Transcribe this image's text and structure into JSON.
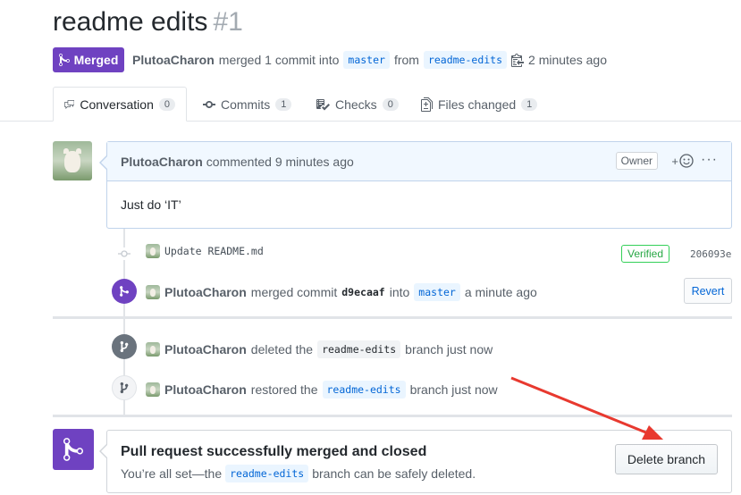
{
  "pr": {
    "title": "readme edits",
    "number": "#1",
    "status": "Merged",
    "author": "PlutoaCharon",
    "merged_text": "merged 1 commit into",
    "base_branch": "master",
    "from_text": "from",
    "head_branch": "readme-edits",
    "time": "2 minutes ago"
  },
  "tabs": [
    {
      "label": "Conversation",
      "count": "0",
      "icon": "conversation-icon"
    },
    {
      "label": "Commits",
      "count": "1",
      "icon": "commit-icon"
    },
    {
      "label": "Checks",
      "count": "0",
      "icon": "checklist-icon"
    },
    {
      "label": "Files changed",
      "count": "1",
      "icon": "file-diff-icon"
    }
  ],
  "comment": {
    "author": "PlutoaCharon",
    "action": "commented 9 minutes ago",
    "owner_label": "Owner",
    "reaction_label": "+",
    "more": "···",
    "body": "Just do ‘IT’"
  },
  "timeline": {
    "commit": {
      "message": "Update README.md",
      "verified": "Verified",
      "sha": "206093e"
    },
    "merge": {
      "author": "PlutoaCharon",
      "text": "merged commit",
      "sha": "d9ecaaf",
      "into_text": "into",
      "branch": "master",
      "time": "a minute ago",
      "revert_label": "Revert"
    },
    "deleted": {
      "author": "PlutoaCharon",
      "text": "deleted the",
      "branch": "readme-edits",
      "suffix": "branch just now"
    },
    "restored": {
      "author": "PlutoaCharon",
      "text": "restored the",
      "branch": "readme-edits",
      "suffix": "branch just now"
    }
  },
  "merge_box": {
    "title": "Pull request successfully merged and closed",
    "sub_prefix": "You’re all set—the",
    "branch": "readme-edits",
    "sub_suffix": "branch can be safely deleted.",
    "delete_label": "Delete branch"
  },
  "colors": {
    "merged": "#6f42c1",
    "link": "#0366d6",
    "verified": "#28a745",
    "annotation_arrow": "#e8392f"
  }
}
